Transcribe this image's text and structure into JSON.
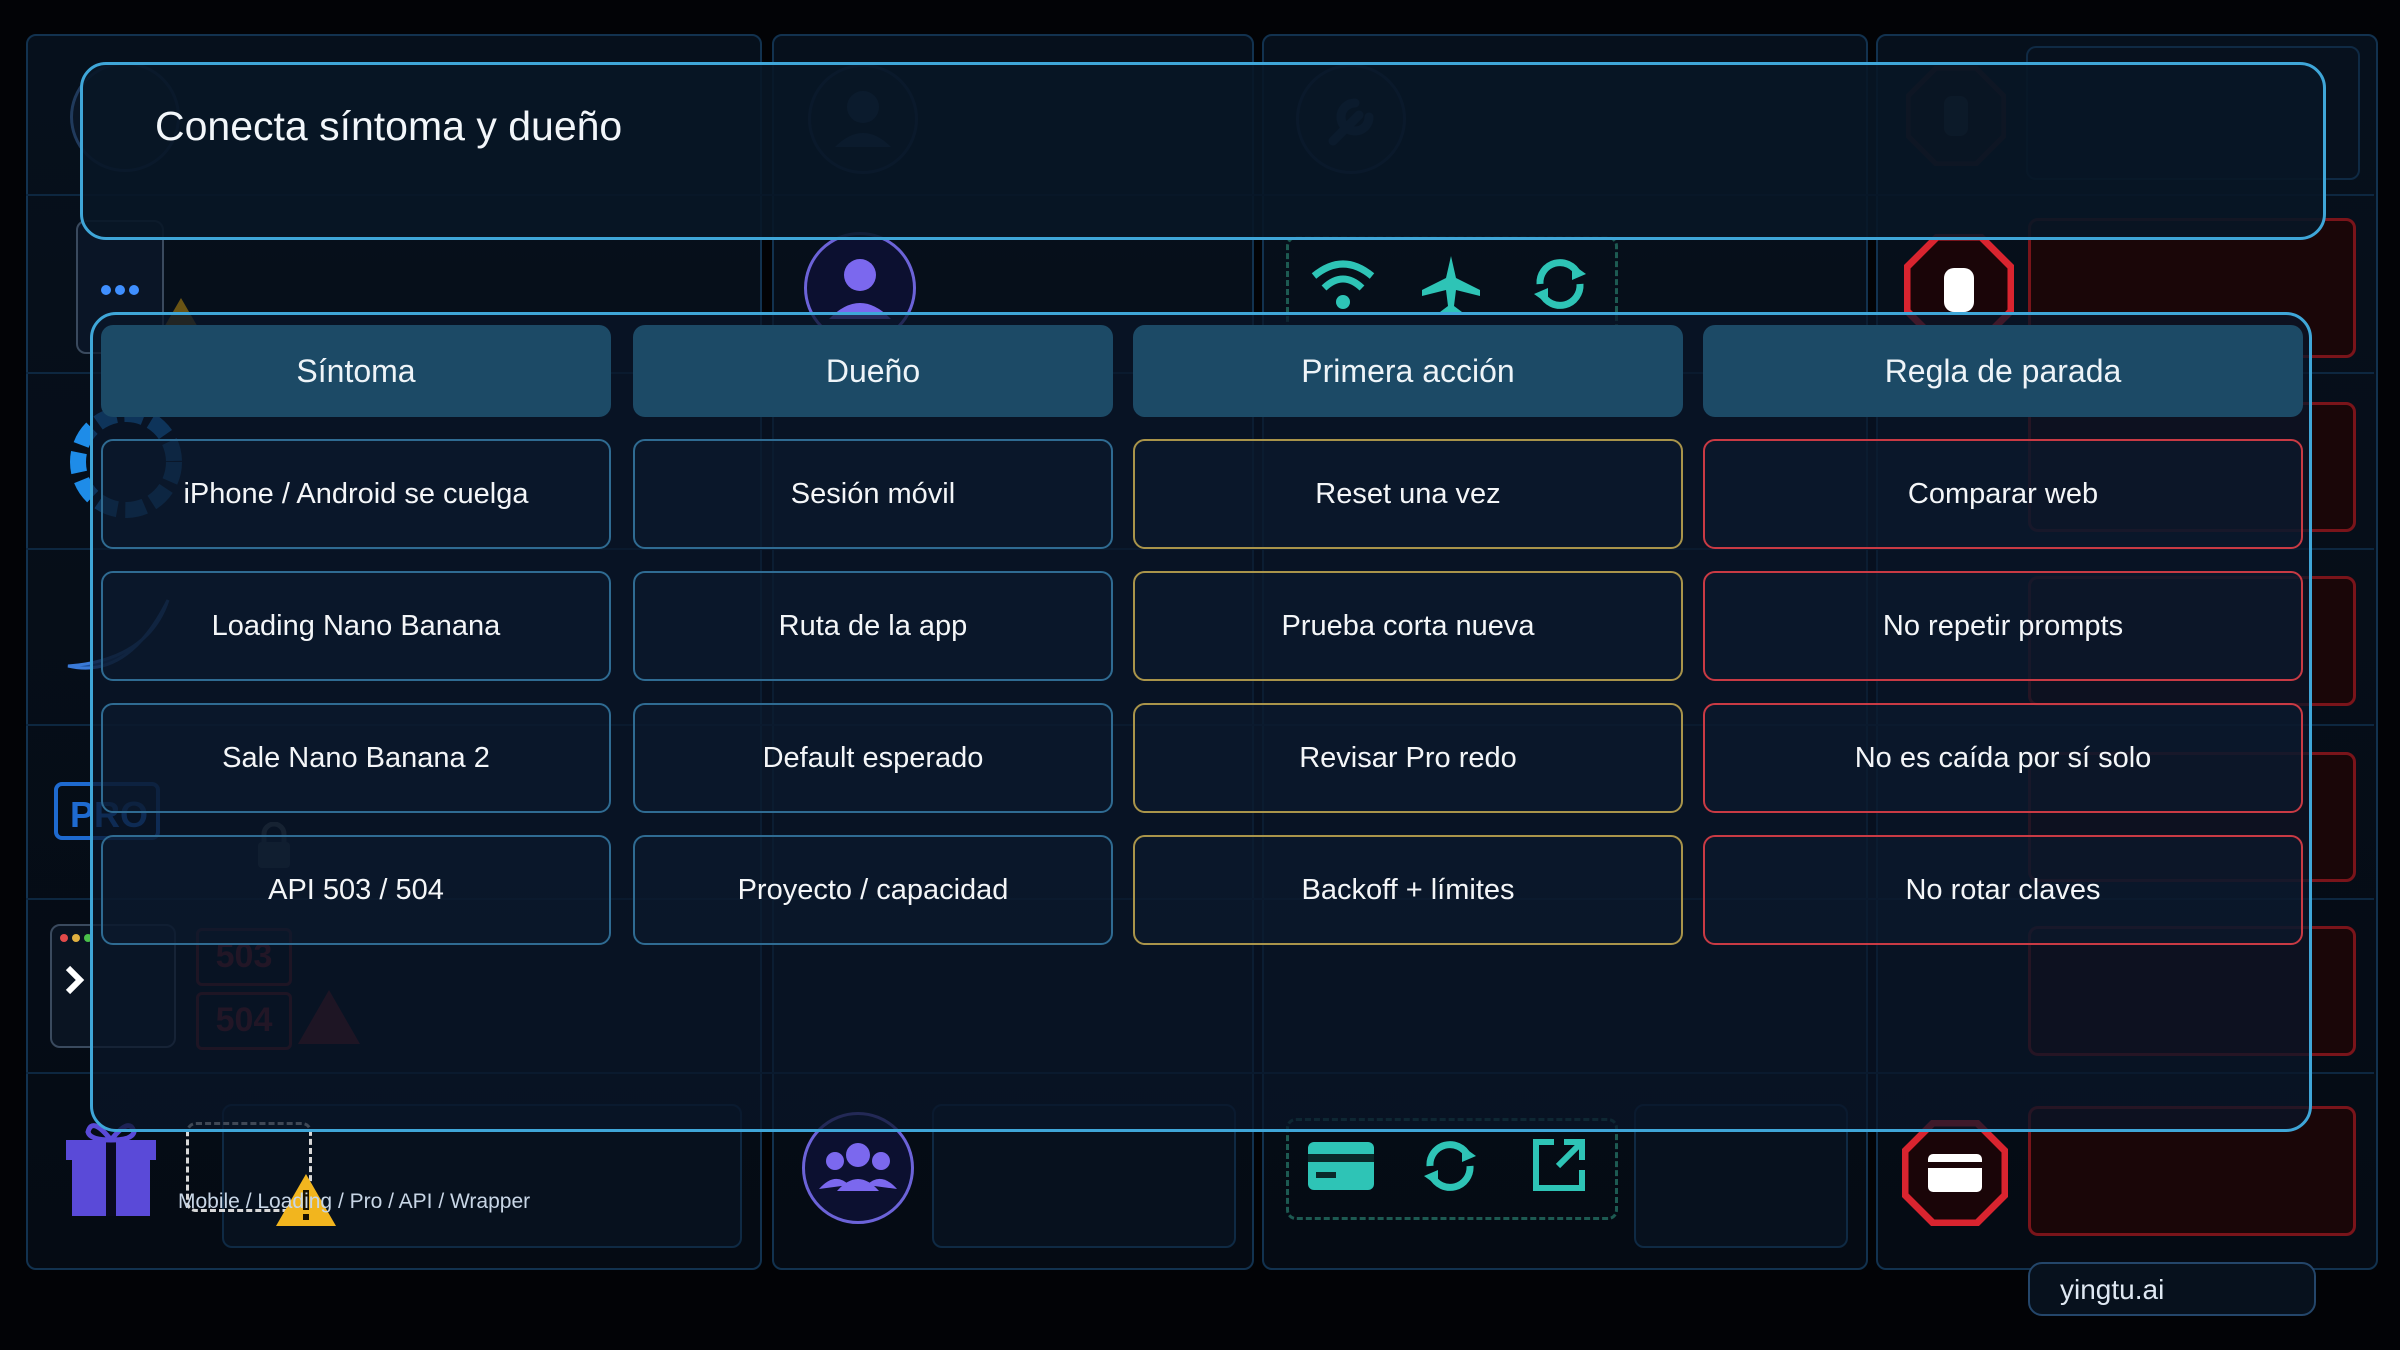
{
  "title": "Conecta síntoma y dueño",
  "table": {
    "headers": [
      "Síntoma",
      "Dueño",
      "Primera acción",
      "Regla de parada"
    ],
    "rows": [
      [
        "iPhone / Android se cuelga",
        "Sesión móvil",
        "Reset una vez",
        "Comparar web"
      ],
      [
        "Loading Nano Banana",
        "Ruta de la app",
        "Prueba corta nueva",
        "No repetir prompts"
      ],
      [
        "Sale Nano Banana 2",
        "Default esperado",
        "Revisar Pro redo",
        "No es caída por sí solo"
      ],
      [
        "API 503 / 504",
        "Proyecto / capacidad",
        "Backoff + límites",
        "No rotar claves"
      ]
    ]
  },
  "background": {
    "pro_label": "PRO",
    "error_codes": [
      "503",
      "504"
    ]
  },
  "footer": {
    "path": "Mobile / Loading / Pro / API / Wrapper"
  },
  "brand": "yingtu.ai",
  "colors": {
    "accent_border": "#3fa6d8",
    "header_fill": "#1c4a66",
    "action_border": "#a9944a",
    "stop_border": "#c93a44",
    "owner_icon": "#7b68ee",
    "teal_icon": "#2ec4b6",
    "danger_red": "#d9242f"
  },
  "icons": [
    "search-icon",
    "user-icon",
    "wrench-icon",
    "hand-stop-icon",
    "wifi-icon",
    "airplane-icon",
    "refresh-icon",
    "hourglass-icon",
    "globe-icon",
    "banana-icon",
    "filter-icon",
    "trash-icon",
    "lock-icon",
    "terminal-icon",
    "cloud-icon",
    "warning-icon",
    "gift-icon",
    "users-icon",
    "credit-card-icon",
    "external-link-icon"
  ]
}
